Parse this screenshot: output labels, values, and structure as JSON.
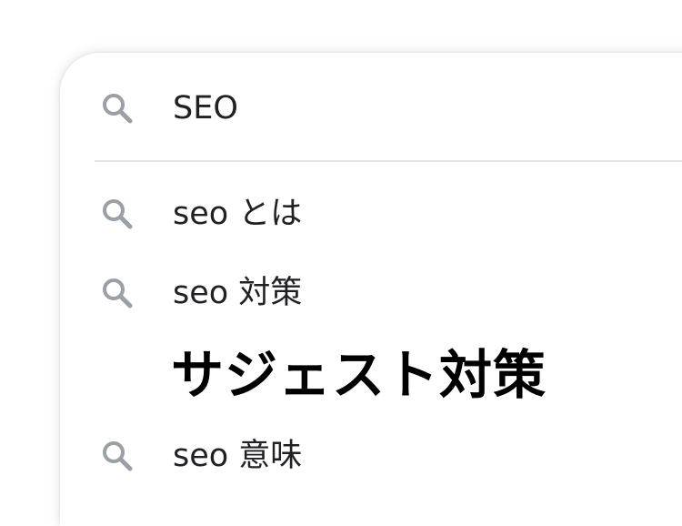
{
  "search": {
    "query": "SEO",
    "icon": "search-icon"
  },
  "suggestions": [
    {
      "label": "seo とは",
      "icon": "search-icon"
    },
    {
      "label": "seo 対策",
      "icon": "search-icon"
    },
    {
      "label": "seo 意味",
      "icon": "search-icon"
    }
  ],
  "overlay": {
    "text": "サジェスト対策"
  },
  "colors": {
    "icon": "#9aa0a6",
    "text": "#202124",
    "divider": "#e4e4e4",
    "overlay": "#000000"
  }
}
